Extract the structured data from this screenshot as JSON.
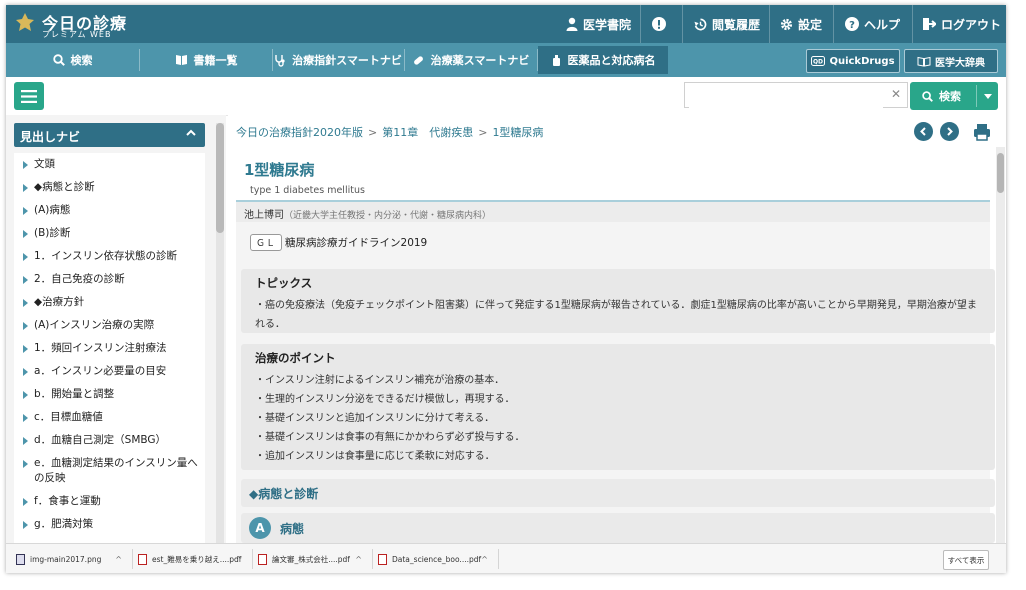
{
  "logo": {
    "title": "今日の診療",
    "subtitle": "プレミアム WEB"
  },
  "topbar": {
    "user_label": "医学書院",
    "history_label": "閲覧履歴",
    "settings_label": "設定",
    "help_label": "ヘルプ",
    "logout_label": "ログアウト"
  },
  "nav": {
    "tabs": [
      "検索",
      "書籍一覧",
      "治療指針スマートナビ",
      "治療薬スマートナビ",
      "医薬品と対応病名"
    ],
    "quickdrugs_label": "QuickDrugs",
    "dictionary_label": "医学大辞典"
  },
  "search": {
    "value": "",
    "placeholder": "",
    "button_label": "検索"
  },
  "sidebar": {
    "header": "見出しナビ",
    "items": [
      "文頭",
      "◆病態と診断",
      "(A)病態",
      "(B)診断",
      "1．インスリン依存状態の診断",
      "2．自己免疫の診断",
      "◆治療方針",
      "(A)インスリン治療の実際",
      "1．頻回インスリン注射療法",
      "a．インスリン必要量の目安",
      "b．開始量と調整",
      "c．目標血糖値",
      "d．血糖自己測定（SMBG）",
      "e．血糖測定結果のインスリン量への反映",
      "f．食事と運動",
      "g．肥満対策"
    ]
  },
  "breadcrumb": [
    "今日の治療指針2020年版",
    "第11章　代謝疾患",
    "1型糖尿病"
  ],
  "article": {
    "title": "1型糖尿病",
    "subtitle": "type 1 diabetes mellitus",
    "author": "池上博司",
    "affiliation": "（近畿大学主任教授・内分泌・代謝・糖尿病内科）",
    "gl_badge": "ＧＬ",
    "gl_text": "糖尿病診療ガイドライン2019",
    "topics": {
      "heading": "トピックス",
      "text": "・癌の免疫療法（免疫チェックポイント阻害薬）に伴って発症する1型糖尿病が報告されている．劇症1型糖尿病の比率が高いことから早期発見，早期治療が望まれる．"
    },
    "points": {
      "heading": "治療のポイント",
      "items": [
        "・インスリン注射によるインスリン補充が治療の基本．",
        "・生理的インスリン分泌をできるだけ模倣し，再現する．",
        "・基礎インスリンと追加インスリンに分けて考える．",
        "・基礎インスリンは食事の有無にかかわらず必ず投与する．",
        "・追加インスリンは食事量に応じて柔軟に対応する．"
      ]
    },
    "section_heading": "◆病態と診断",
    "subsection_letter": "A",
    "subsection_label": "病態"
  },
  "downloads": {
    "items": [
      "img-main2017.png",
      "est_難易を乗り越え....pdf",
      "論文審_株式会社....pdf",
      "Data_science_boo....pdf"
    ],
    "show_all": "すべて表示"
  },
  "colors": {
    "header": "#2f6f86",
    "nav": "#4d95ab",
    "accent": "#29a68a"
  }
}
